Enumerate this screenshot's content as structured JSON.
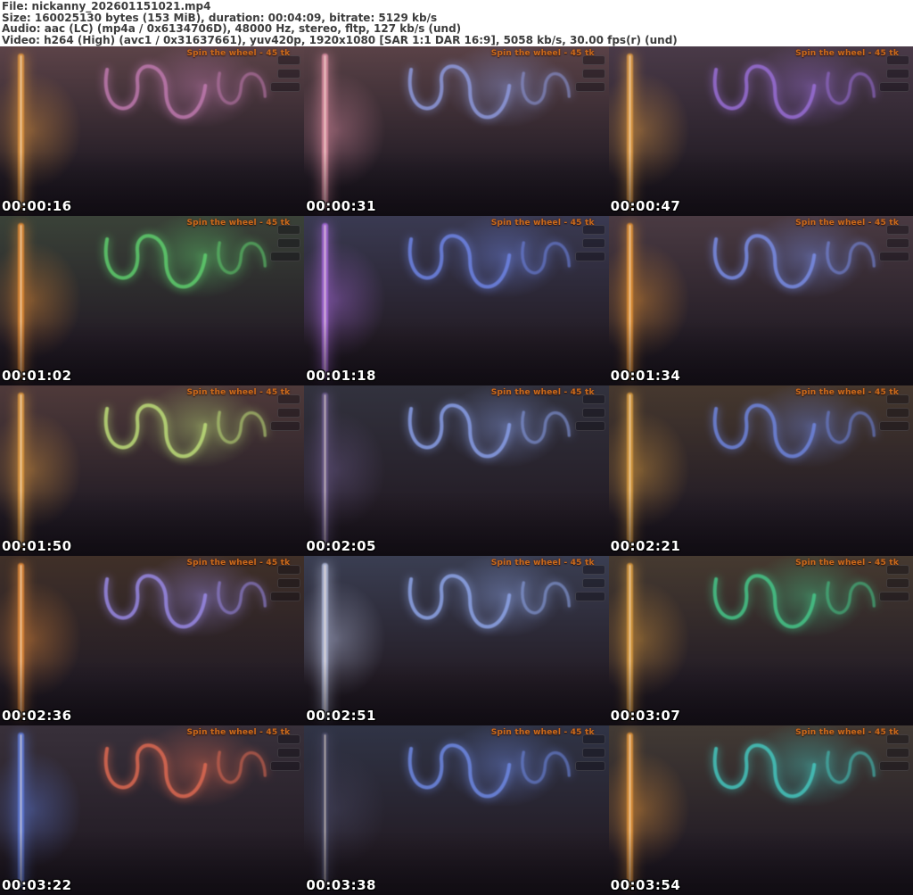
{
  "header": {
    "file_line": "File: nickanny_202601151021.mp4",
    "size_line": "Size: 160025130 bytes (153 MiB), duration: 00:04:09, bitrate: 5129 kb/s",
    "audio_line": "Audio: aac (LC) (mp4a / 0x6134706D), 48000 Hz, stereo, fltp, 127 kb/s (und)",
    "video_line": "Video: h264 (High) (avc1 / 0x31637661), yuv420p, 1920x1080 [SAR 1:1 DAR 16:9], 5058 kb/s, 30.00 fps(r) (und)",
    "text_color": "#3c3c3c",
    "background": "#ffffff"
  },
  "thumbnails": {
    "columns": 3,
    "rows": 5,
    "overlay_text": "Spin the wheel - 45 tk",
    "overlay_color": "#c96a1c",
    "timestamp_color": "#ffffff",
    "tiles": [
      {
        "timestamp": "00:00:16",
        "base": "#5c4348",
        "accent1": "#c07ab0",
        "accent2": "#e0953f"
      },
      {
        "timestamp": "00:00:31",
        "base": "#5a4247",
        "accent1": "#8f9bdf",
        "accent2": "#d98ba0"
      },
      {
        "timestamp": "00:00:47",
        "base": "#4a3a48",
        "accent1": "#9a6fd8",
        "accent2": "#e09a42"
      },
      {
        "timestamp": "00:01:02",
        "base": "#3a4238",
        "accent1": "#5fd06e",
        "accent2": "#e08a34"
      },
      {
        "timestamp": "00:01:18",
        "base": "#3a3a52",
        "accent1": "#6f86e8",
        "accent2": "#a468d8"
      },
      {
        "timestamp": "00:01:34",
        "base": "#4a3a42",
        "accent1": "#7a8ee8",
        "accent2": "#e08f33"
      },
      {
        "timestamp": "00:01:50",
        "base": "#4f3a3a",
        "accent1": "#bfe07a",
        "accent2": "#e09a40"
      },
      {
        "timestamp": "00:02:05",
        "base": "#32323e",
        "accent1": "#8aa0ea",
        "accent2": "#6a5a8a"
      },
      {
        "timestamp": "00:02:21",
        "base": "#46382e",
        "accent1": "#6f86e0",
        "accent2": "#d89a3e"
      },
      {
        "timestamp": "00:02:36",
        "base": "#403028",
        "accent1": "#9a8ae8",
        "accent2": "#e08838"
      },
      {
        "timestamp": "00:02:51",
        "base": "#3a3e52",
        "accent1": "#8fa6ea",
        "accent2": "#b0b8d8"
      },
      {
        "timestamp": "00:03:07",
        "base": "#463a30",
        "accent1": "#46c88a",
        "accent2": "#d8983c"
      },
      {
        "timestamp": "00:03:22",
        "base": "#38303a",
        "accent1": "#e06a52",
        "accent2": "#5f7ad8"
      },
      {
        "timestamp": "00:03:38",
        "base": "#303446",
        "accent1": "#6f8ae6",
        "accent2": "#4a4a66"
      },
      {
        "timestamp": "00:03:54",
        "base": "#423a34",
        "accent1": "#45c8c0",
        "accent2": "#e09238"
      }
    ]
  }
}
